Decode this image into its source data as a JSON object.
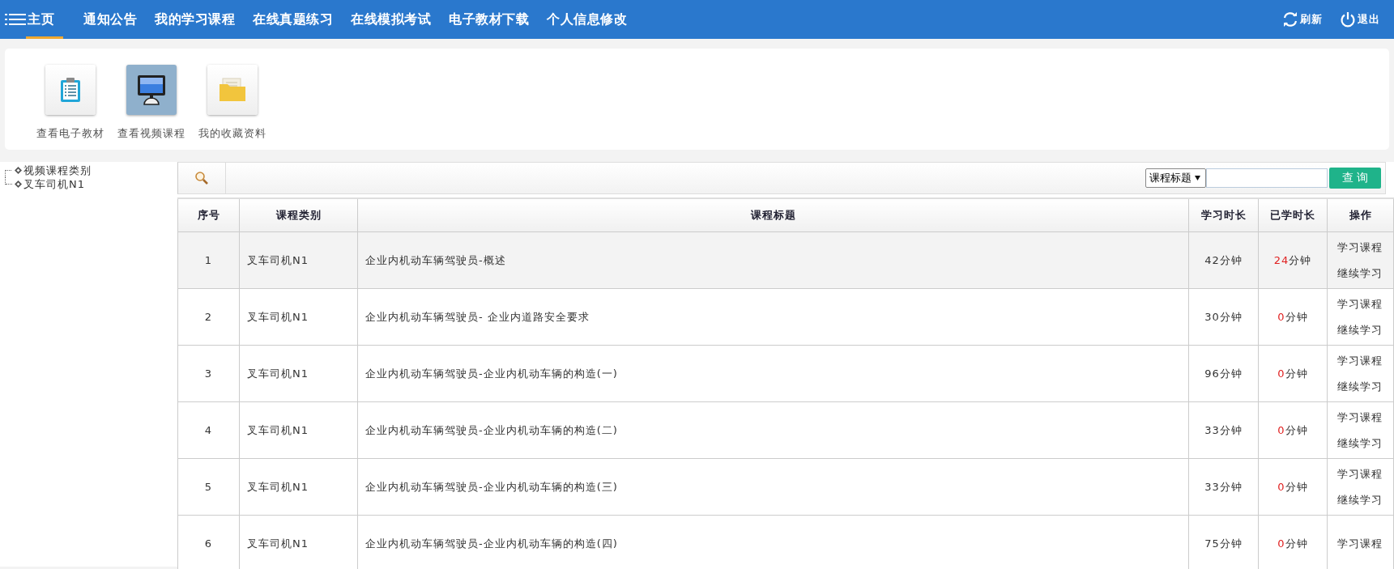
{
  "nav": {
    "items": [
      {
        "label": "主页",
        "selected": true
      },
      {
        "label": "通知公告",
        "selected": false
      },
      {
        "label": "我的学习课程",
        "selected": false
      },
      {
        "label": "在线真题练习",
        "selected": false
      },
      {
        "label": "在线模拟考试",
        "selected": false
      },
      {
        "label": "电子教材下载",
        "selected": false
      },
      {
        "label": "个人信息修改",
        "selected": false
      }
    ],
    "actions": [
      {
        "kind": "refresh",
        "label": "刷新"
      },
      {
        "kind": "logout",
        "label": "退出"
      }
    ]
  },
  "tools": [
    {
      "kind": "textbook",
      "label": "查看电子教材",
      "selected": false
    },
    {
      "kind": "video",
      "label": "查看视频课程",
      "selected": true
    },
    {
      "kind": "favorites",
      "label": "我的收藏资料",
      "selected": false
    }
  ],
  "tree": {
    "items": [
      {
        "label": "视频课程类别"
      },
      {
        "label": "叉车司机N1"
      }
    ]
  },
  "search": {
    "field": "课程标题",
    "button": "查 询"
  },
  "table": {
    "columns": [
      "序号",
      "课程类别",
      "课程标题",
      "学习时长",
      "已学时长",
      "操作"
    ],
    "rows": [
      {
        "index": "1",
        "category": "叉车司机N1",
        "title": "企业内机动车辆驾驶员-概述",
        "duration": "42分钟",
        "learned_value": "24",
        "learned_unit": "分钟",
        "actions": [
          "学习课程",
          "继续学习"
        ],
        "highlighted": true
      },
      {
        "index": "2",
        "category": "叉车司机N1",
        "title": "企业内机动车辆驾驶员- 企业内道路安全要求",
        "duration": "30分钟",
        "learned_value": "0",
        "learned_unit": "分钟",
        "actions": [
          "学习课程",
          "继续学习"
        ],
        "highlighted": false
      },
      {
        "index": "3",
        "category": "叉车司机N1",
        "title": "企业内机动车辆驾驶员-企业内机动车辆的构造(一)",
        "duration": "96分钟",
        "learned_value": "0",
        "learned_unit": "分钟",
        "actions": [
          "学习课程",
          "继续学习"
        ],
        "highlighted": false
      },
      {
        "index": "4",
        "category": "叉车司机N1",
        "title": "企业内机动车辆驾驶员-企业内机动车辆的构造(二)",
        "duration": "33分钟",
        "learned_value": "0",
        "learned_unit": "分钟",
        "actions": [
          "学习课程",
          "继续学习"
        ],
        "highlighted": false
      },
      {
        "index": "5",
        "category": "叉车司机N1",
        "title": "企业内机动车辆驾驶员-企业内机动车辆的构造(三)",
        "duration": "33分钟",
        "learned_value": "0",
        "learned_unit": "分钟",
        "actions": [
          "学习课程",
          "继续学习"
        ],
        "highlighted": false
      },
      {
        "index": "6",
        "category": "叉车司机N1",
        "title": "企业内机动车辆驾驶员-企业内机动车辆的构造(四)",
        "duration": "75分钟",
        "learned_value": "0",
        "learned_unit": "分钟",
        "actions": [
          "学习课程"
        ],
        "highlighted": false
      }
    ]
  }
}
